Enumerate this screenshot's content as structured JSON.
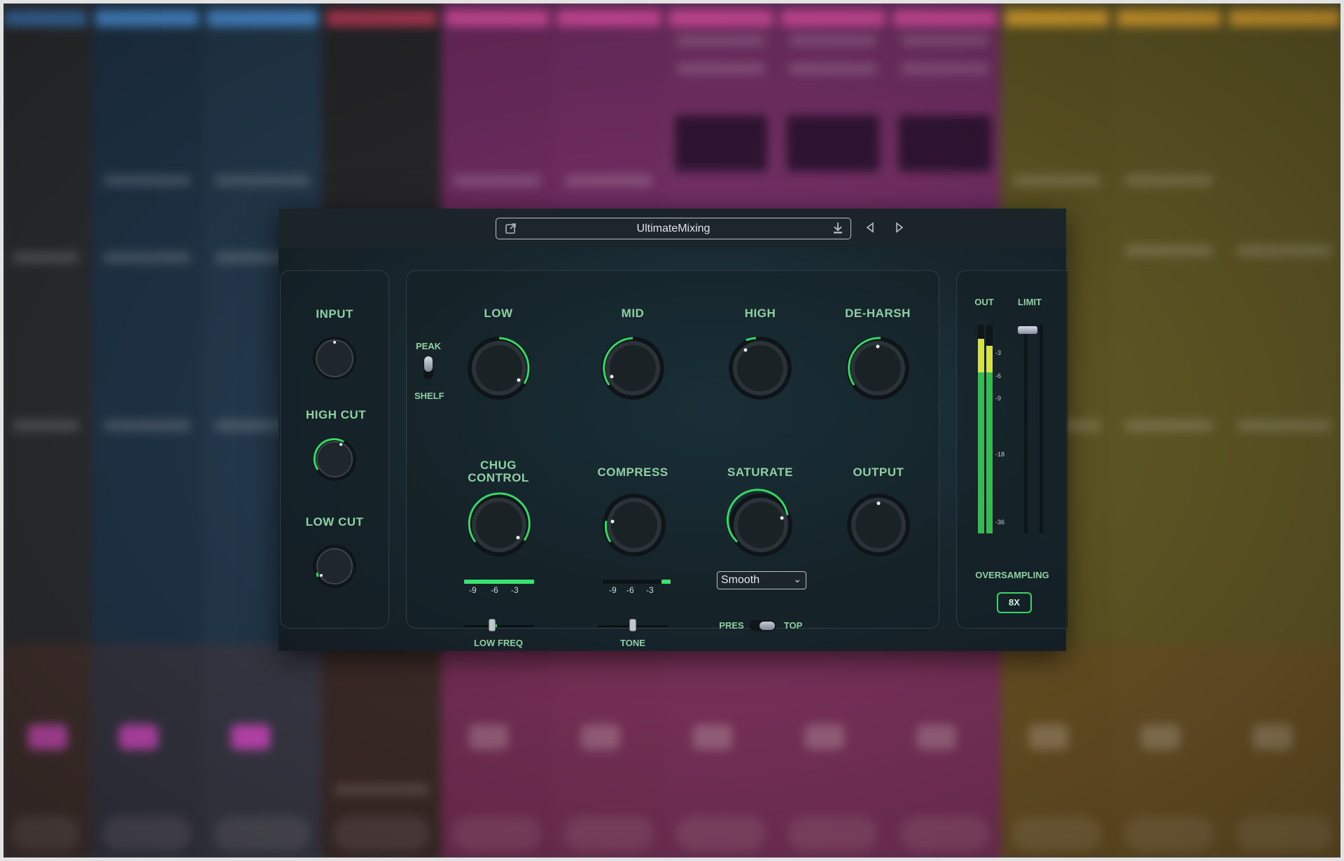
{
  "window": {
    "preset_name": "UltimateMixing"
  },
  "left_panel": {
    "input": "INPUT",
    "high_cut": "HIGH CUT",
    "low_cut": "LOW CUT"
  },
  "eq": {
    "peak": "PEAK",
    "shelf": "SHELF",
    "low": "LOW",
    "mid": "MID",
    "high": "HIGH",
    "de_harsh": "DE-HARSH",
    "low_freq": "LOW FREQ",
    "tone": "TONE",
    "pres": "PRES",
    "top": "TOP"
  },
  "dynamics": {
    "chug_control_line1": "CHUG",
    "chug_control_line2": "CONTROL",
    "compress": "COMPRESS",
    "saturate": "SATURATE",
    "output": "OUTPUT",
    "scale": [
      "-9",
      "-6",
      "-3"
    ],
    "saturate_mode": "Smooth"
  },
  "meters": {
    "out": "OUT",
    "limit": "LIMIT",
    "scale": [
      "-3",
      "-6",
      "-9",
      "-18",
      "-36"
    ],
    "oversampling_label": "OVERSAMPLING",
    "oversampling_value": "8X"
  },
  "colors": {
    "accent": "#3ae36b",
    "label": "#8fd0a3",
    "peak": "#d7e23a"
  }
}
